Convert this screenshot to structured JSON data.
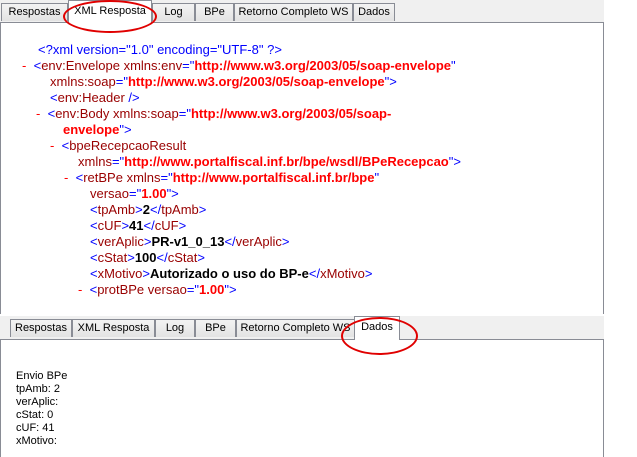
{
  "tabs": [
    "Respostas",
    "XML Resposta",
    "Log",
    "BPe",
    "Retorno Completo WS",
    "Dados"
  ],
  "top_panel": {
    "active_tab": "XML Resposta"
  },
  "bottom_panel": {
    "active_tab": "Dados"
  },
  "xml": {
    "pi": "<?xml version=\"1.0\" encoding=\"UTF-8\" ?>",
    "envelope_tag": "env:Envelope",
    "xmlns_env_attr": "xmlns:env",
    "xmlns_env_val": "http://www.w3.org/2003/05/soap-envelope",
    "xmlns_soap_attr": "xmlns:soap",
    "xmlns_soap_val": "http://www.w3.org/2003/05/soap-envelope",
    "header_tag": "env:Header",
    "body_tag": "env:Body",
    "body_xmlns_attr": "xmlns:soap",
    "body_xmlns_val_1": "http://www.w3.org/2003/05/soap-",
    "body_xmlns_val_2": "envelope",
    "result_tag": "bpeRecepcaoResult",
    "result_xmlns_attr": "xmlns",
    "result_xmlns_val": "http://www.portalfiscal.inf.br/bpe/wsdl/BPeRecepcao",
    "retbpe_tag": "retBPe",
    "retbpe_xmlns_attr": "xmlns",
    "retbpe_xmlns_val": "http://www.portalfiscal.inf.br/bpe",
    "versao_attr": "versao",
    "versao_val": "1.00",
    "tpamb_tag": "tpAmb",
    "tpamb_val": "2",
    "cuf_tag": "cUF",
    "cuf_val": "41",
    "veraplic_tag": "verAplic",
    "veraplic_val": "PR-v1_0_13",
    "cstat_tag": "cStat",
    "cstat_val": "100",
    "xmotivo_tag": "xMotivo",
    "xmotivo_val": "Autorizado o uso do BP-e",
    "protbpe_tag": "protBPe",
    "protbpe_versao_attr": "versao",
    "protbpe_versao_val": "1.00",
    "collapse_marker": "-"
  },
  "dados": {
    "lines": [
      "Envio BPe",
      "tpAmb: 2",
      "verAplic:",
      "cStat: 0",
      "cUF: 41",
      "xMotivo:"
    ]
  },
  "highlight_color": "#e00000"
}
